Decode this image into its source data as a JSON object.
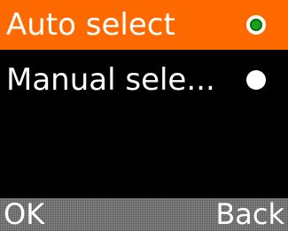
{
  "menu": {
    "items": [
      {
        "label": "Auto select",
        "selected": true,
        "checked": true
      },
      {
        "label": "Manual sele...",
        "selected": false,
        "checked": false
      }
    ]
  },
  "softkeys": {
    "left": "OK",
    "right": "Back"
  },
  "colors": {
    "highlight": "#ff6a00",
    "background": "#000000",
    "radio_checked": "#17a317",
    "softkey_bar": "#8a8a8a"
  }
}
